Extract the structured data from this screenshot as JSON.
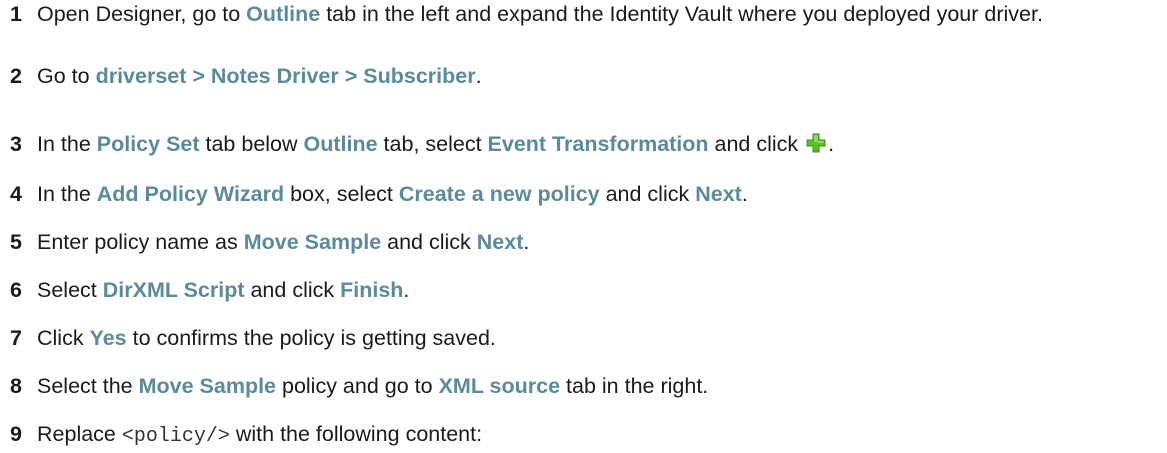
{
  "steps": [
    {
      "num": "1",
      "parts": [
        {
          "t": "Open Designer, go to "
        },
        {
          "t": "Outline",
          "hl": true
        },
        {
          "t": " tab in the left and expand the Identity Vault where you deployed your driver."
        }
      ]
    },
    {
      "num": "2",
      "parts": [
        {
          "t": "Go to "
        },
        {
          "t": "driverset > Notes Driver > Subscriber",
          "hl": true
        },
        {
          "t": "."
        }
      ]
    },
    {
      "num": "3",
      "parts": [
        {
          "t": "In the "
        },
        {
          "t": "Policy Set",
          "hl": true
        },
        {
          "t": " tab below "
        },
        {
          "t": "Outline",
          "hl": true
        },
        {
          "t": " tab, select "
        },
        {
          "t": "Event Transformation",
          "hl": true
        },
        {
          "t": " and click "
        },
        {
          "icon": "plus-icon"
        },
        {
          "t": "."
        }
      ]
    },
    {
      "num": "4",
      "parts": [
        {
          "t": "In the "
        },
        {
          "t": "Add Policy Wizard",
          "hl": true
        },
        {
          "t": " box, select "
        },
        {
          "t": "Create a new policy",
          "hl": true
        },
        {
          "t": " and click "
        },
        {
          "t": "Next",
          "hl": true
        },
        {
          "t": "."
        }
      ]
    },
    {
      "num": "5",
      "parts": [
        {
          "t": "Enter policy name as "
        },
        {
          "t": "Move Sample",
          "hl": true
        },
        {
          "t": " and click "
        },
        {
          "t": "Next",
          "hl": true
        },
        {
          "t": "."
        }
      ]
    },
    {
      "num": "6",
      "parts": [
        {
          "t": "Select "
        },
        {
          "t": "DirXML Script",
          "hl": true
        },
        {
          "t": " and click "
        },
        {
          "t": "Finish",
          "hl": true
        },
        {
          "t": "."
        }
      ]
    },
    {
      "num": "7",
      "parts": [
        {
          "t": "Click "
        },
        {
          "t": "Yes",
          "hl": true
        },
        {
          "t": " to confirms the policy is getting saved."
        }
      ]
    },
    {
      "num": "8",
      "parts": [
        {
          "t": "Select the "
        },
        {
          "t": "Move Sample",
          "hl": true
        },
        {
          "t": " policy and go to "
        },
        {
          "t": "XML source",
          "hl": true
        },
        {
          "t": " tab in the right."
        }
      ]
    },
    {
      "num": "9",
      "parts": [
        {
          "t": "Replace "
        },
        {
          "t": "<policy/>",
          "code": true
        },
        {
          "t": " with the following content:"
        }
      ]
    }
  ],
  "colors": {
    "highlight": "#5b8a9b",
    "icon_green": "#5cbf2a"
  }
}
